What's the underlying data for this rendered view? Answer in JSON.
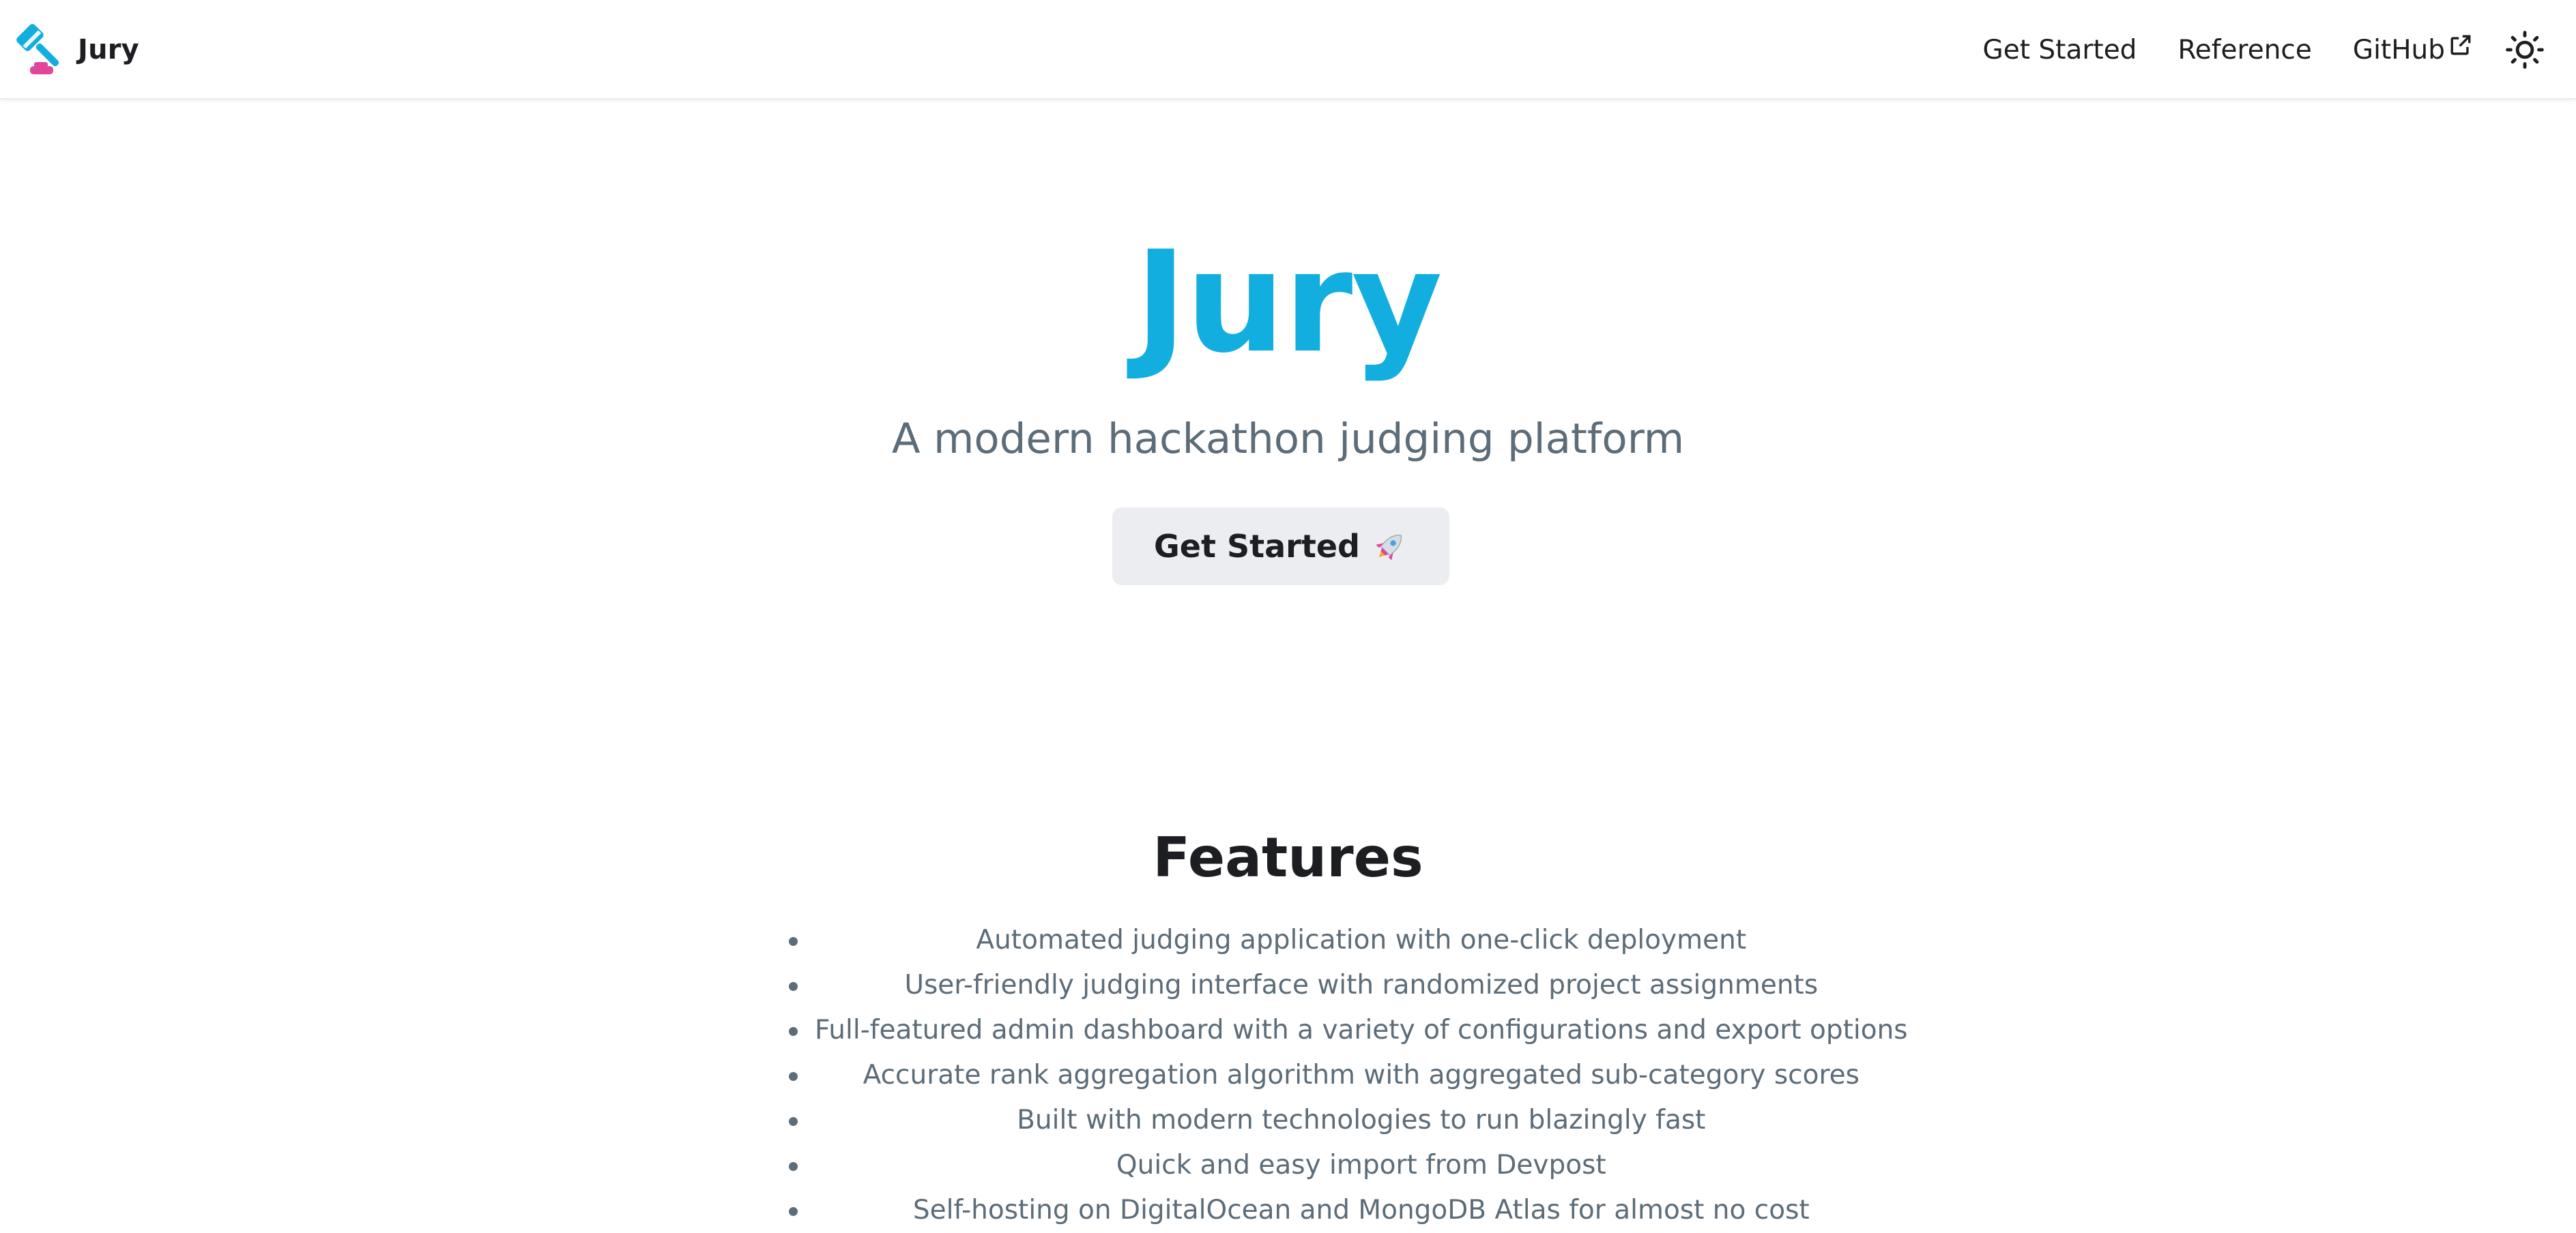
{
  "navbar": {
    "brand_title": "Jury",
    "links": {
      "get_started": "Get Started",
      "reference": "Reference",
      "github": "GitHub"
    },
    "icons": {
      "logo": "gavel-logo-icon",
      "external": "external-link-icon",
      "theme": "sun-icon"
    }
  },
  "hero": {
    "title": "Jury",
    "tagline": "A modern hackathon judging platform",
    "cta_label": "Get Started",
    "cta_icon": "rocket-icon"
  },
  "features": {
    "title": "Features",
    "items": [
      "Automated judging application with one-click deployment",
      "User-friendly judging interface with randomized project assignments",
      "Full-featured admin dashboard with a variety of configurations and export options",
      "Accurate rank aggregation algorithm with aggregated sub-category scores",
      "Built with modern technologies to run blazingly fast",
      "Quick and easy import from Devpost",
      "Self-hosting on DigitalOcean and MongoDB Atlas for almost no cost"
    ]
  },
  "colors": {
    "accent": "#12aee0",
    "logo_pink": "#e0479a",
    "muted_text": "#5c6c78",
    "button_bg": "#ebedf0"
  }
}
